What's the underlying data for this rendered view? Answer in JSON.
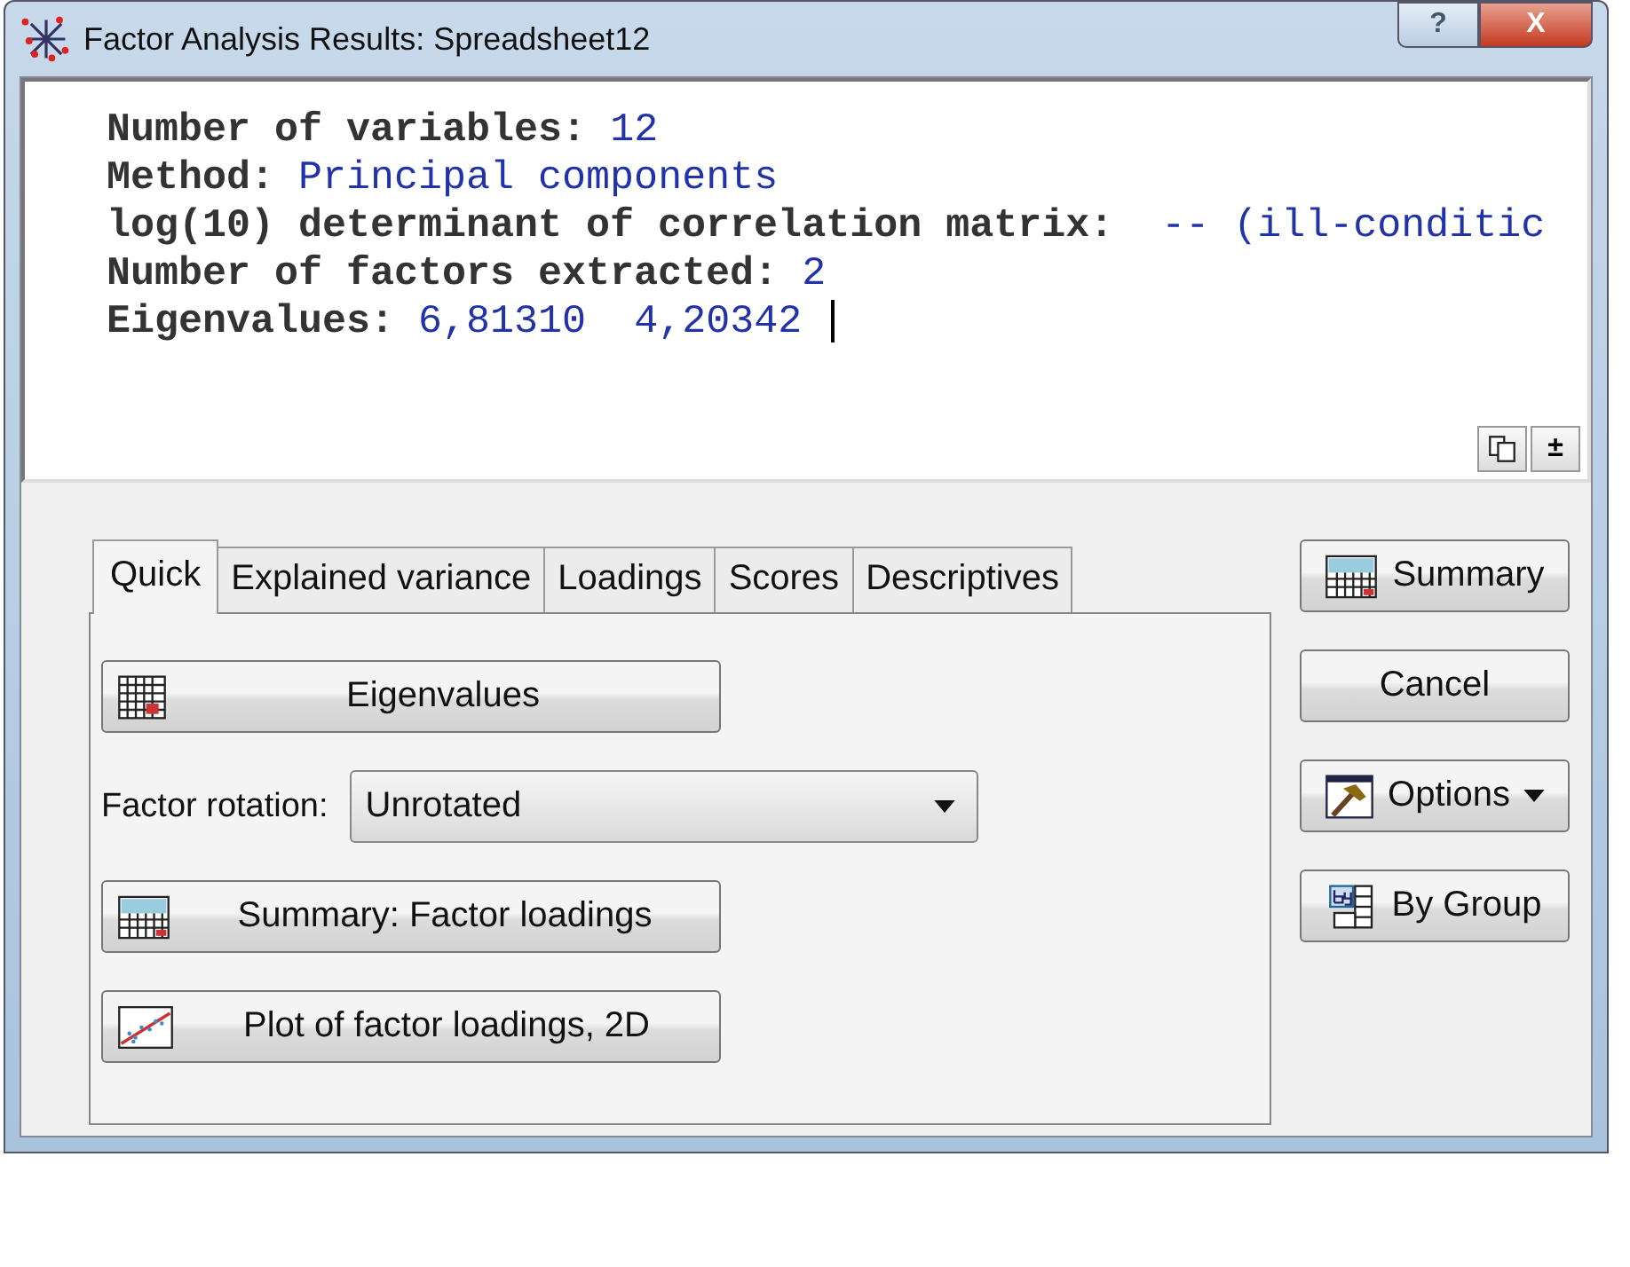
{
  "window": {
    "title": "Factor Analysis Results: Spreadsheet12",
    "buttons": [
      {
        "kind": "help",
        "label": "?"
      },
      {
        "kind": "close",
        "label": "X"
      }
    ]
  },
  "output": {
    "lines": [
      {
        "label": "Number of variables:",
        "value": "12"
      },
      {
        "label": "Method:",
        "value": "Principal components"
      },
      {
        "label": "log(10) determinant of correlation matrix:",
        "value": " -- (ill-conditic"
      },
      {
        "label": "Number of factors extracted:",
        "value": "2"
      },
      {
        "label": "Eigenvalues:",
        "value": "6,81310  4,20342"
      }
    ],
    "tools": [
      {
        "kind": "copy"
      },
      {
        "kind": "toggle",
        "label": "±"
      }
    ]
  },
  "tabs": [
    {
      "label": "Quick",
      "selected": true
    },
    {
      "label": "Explained variance",
      "selected": false
    },
    {
      "label": "Loadings",
      "selected": false
    },
    {
      "label": "Scores",
      "selected": false
    },
    {
      "label": "Descriptives",
      "selected": false
    }
  ],
  "quick": {
    "items": [
      {
        "kind": "button",
        "label": "Eigenvalues"
      },
      {
        "kind": "dropdown",
        "label": "Factor rotation:",
        "value": "Unrotated"
      },
      {
        "kind": "button",
        "label": "Summary: Factor loadings"
      },
      {
        "kind": "button",
        "label": "Plot of factor loadings, 2D"
      }
    ]
  },
  "side_buttons": [
    {
      "label": "Summary",
      "menu": false
    },
    {
      "label": "Cancel",
      "menu": false
    },
    {
      "label": "Options",
      "menu": true
    },
    {
      "label": "By Group",
      "menu": false
    }
  ]
}
